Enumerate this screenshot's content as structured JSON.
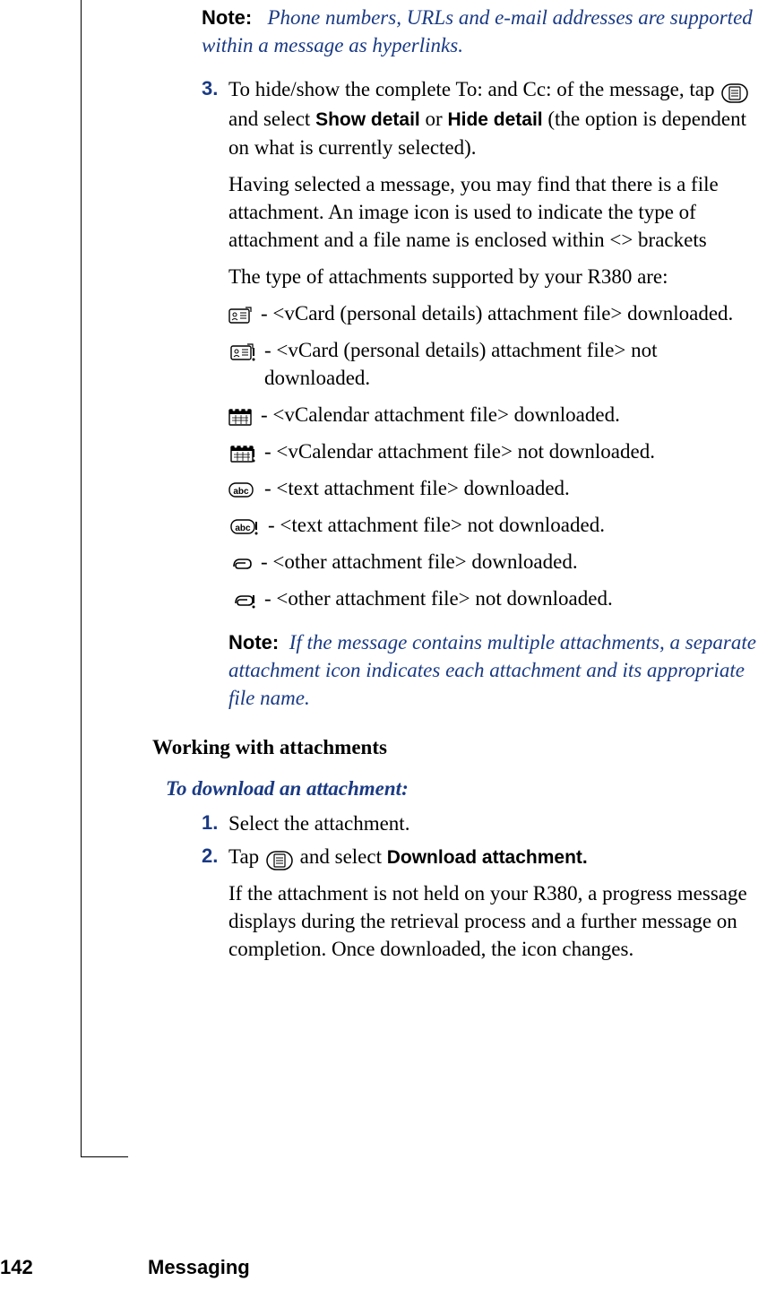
{
  "note1": {
    "label": "Note:",
    "text": "Phone numbers, URLs and e-mail addresses are supported within a message as hyperlinks."
  },
  "step3": {
    "num": "3.",
    "pre": "To hide/show the complete To: and Cc: of the message, tap ",
    "mid1": " and select ",
    "bold1": "Show detail",
    "mid2": " or ",
    "bold2": "Hide detail",
    "post": " (the option is dependent on what is currently selected)."
  },
  "para1": "Having selected a message, you may find that there is a file attachment. An image icon is used to indicate the type of attachment and a file name is enclosed within <> brackets",
  "para2": "The type of attachments supported by your R380 are:",
  "attachments": [
    " - <vCard (personal details) attachment file> downloaded.",
    " - <vCard (personal details) attachment file> not downloaded.",
    " - <vCalendar attachment file> downloaded.",
    " - <vCalendar attachment file> not downloaded.",
    " - <text attachment file> downloaded.",
    " - <text attachment file> not downloaded.",
    " - <other attachment file> downloaded.",
    " - <other attachment file> not downloaded."
  ],
  "note2": {
    "label": "Note:",
    "text": "If the message contains multiple attachments, a separate attachment icon indicates each attachment and its appropriate file name."
  },
  "heading": "Working with attachments",
  "subhead": "To download an attachment:",
  "dl_step1": {
    "num": "1.",
    "text": "Select the attachment."
  },
  "dl_step2": {
    "num": "2.",
    "pre": "Tap ",
    "mid": " and select ",
    "bold": "Download attachment."
  },
  "dl_para": "If the attachment is not held on your R380, a progress message displays during the retrieval process and a further message on completion. Once downloaded, the icon changes.",
  "footer": {
    "page": "142",
    "section": "Messaging"
  }
}
